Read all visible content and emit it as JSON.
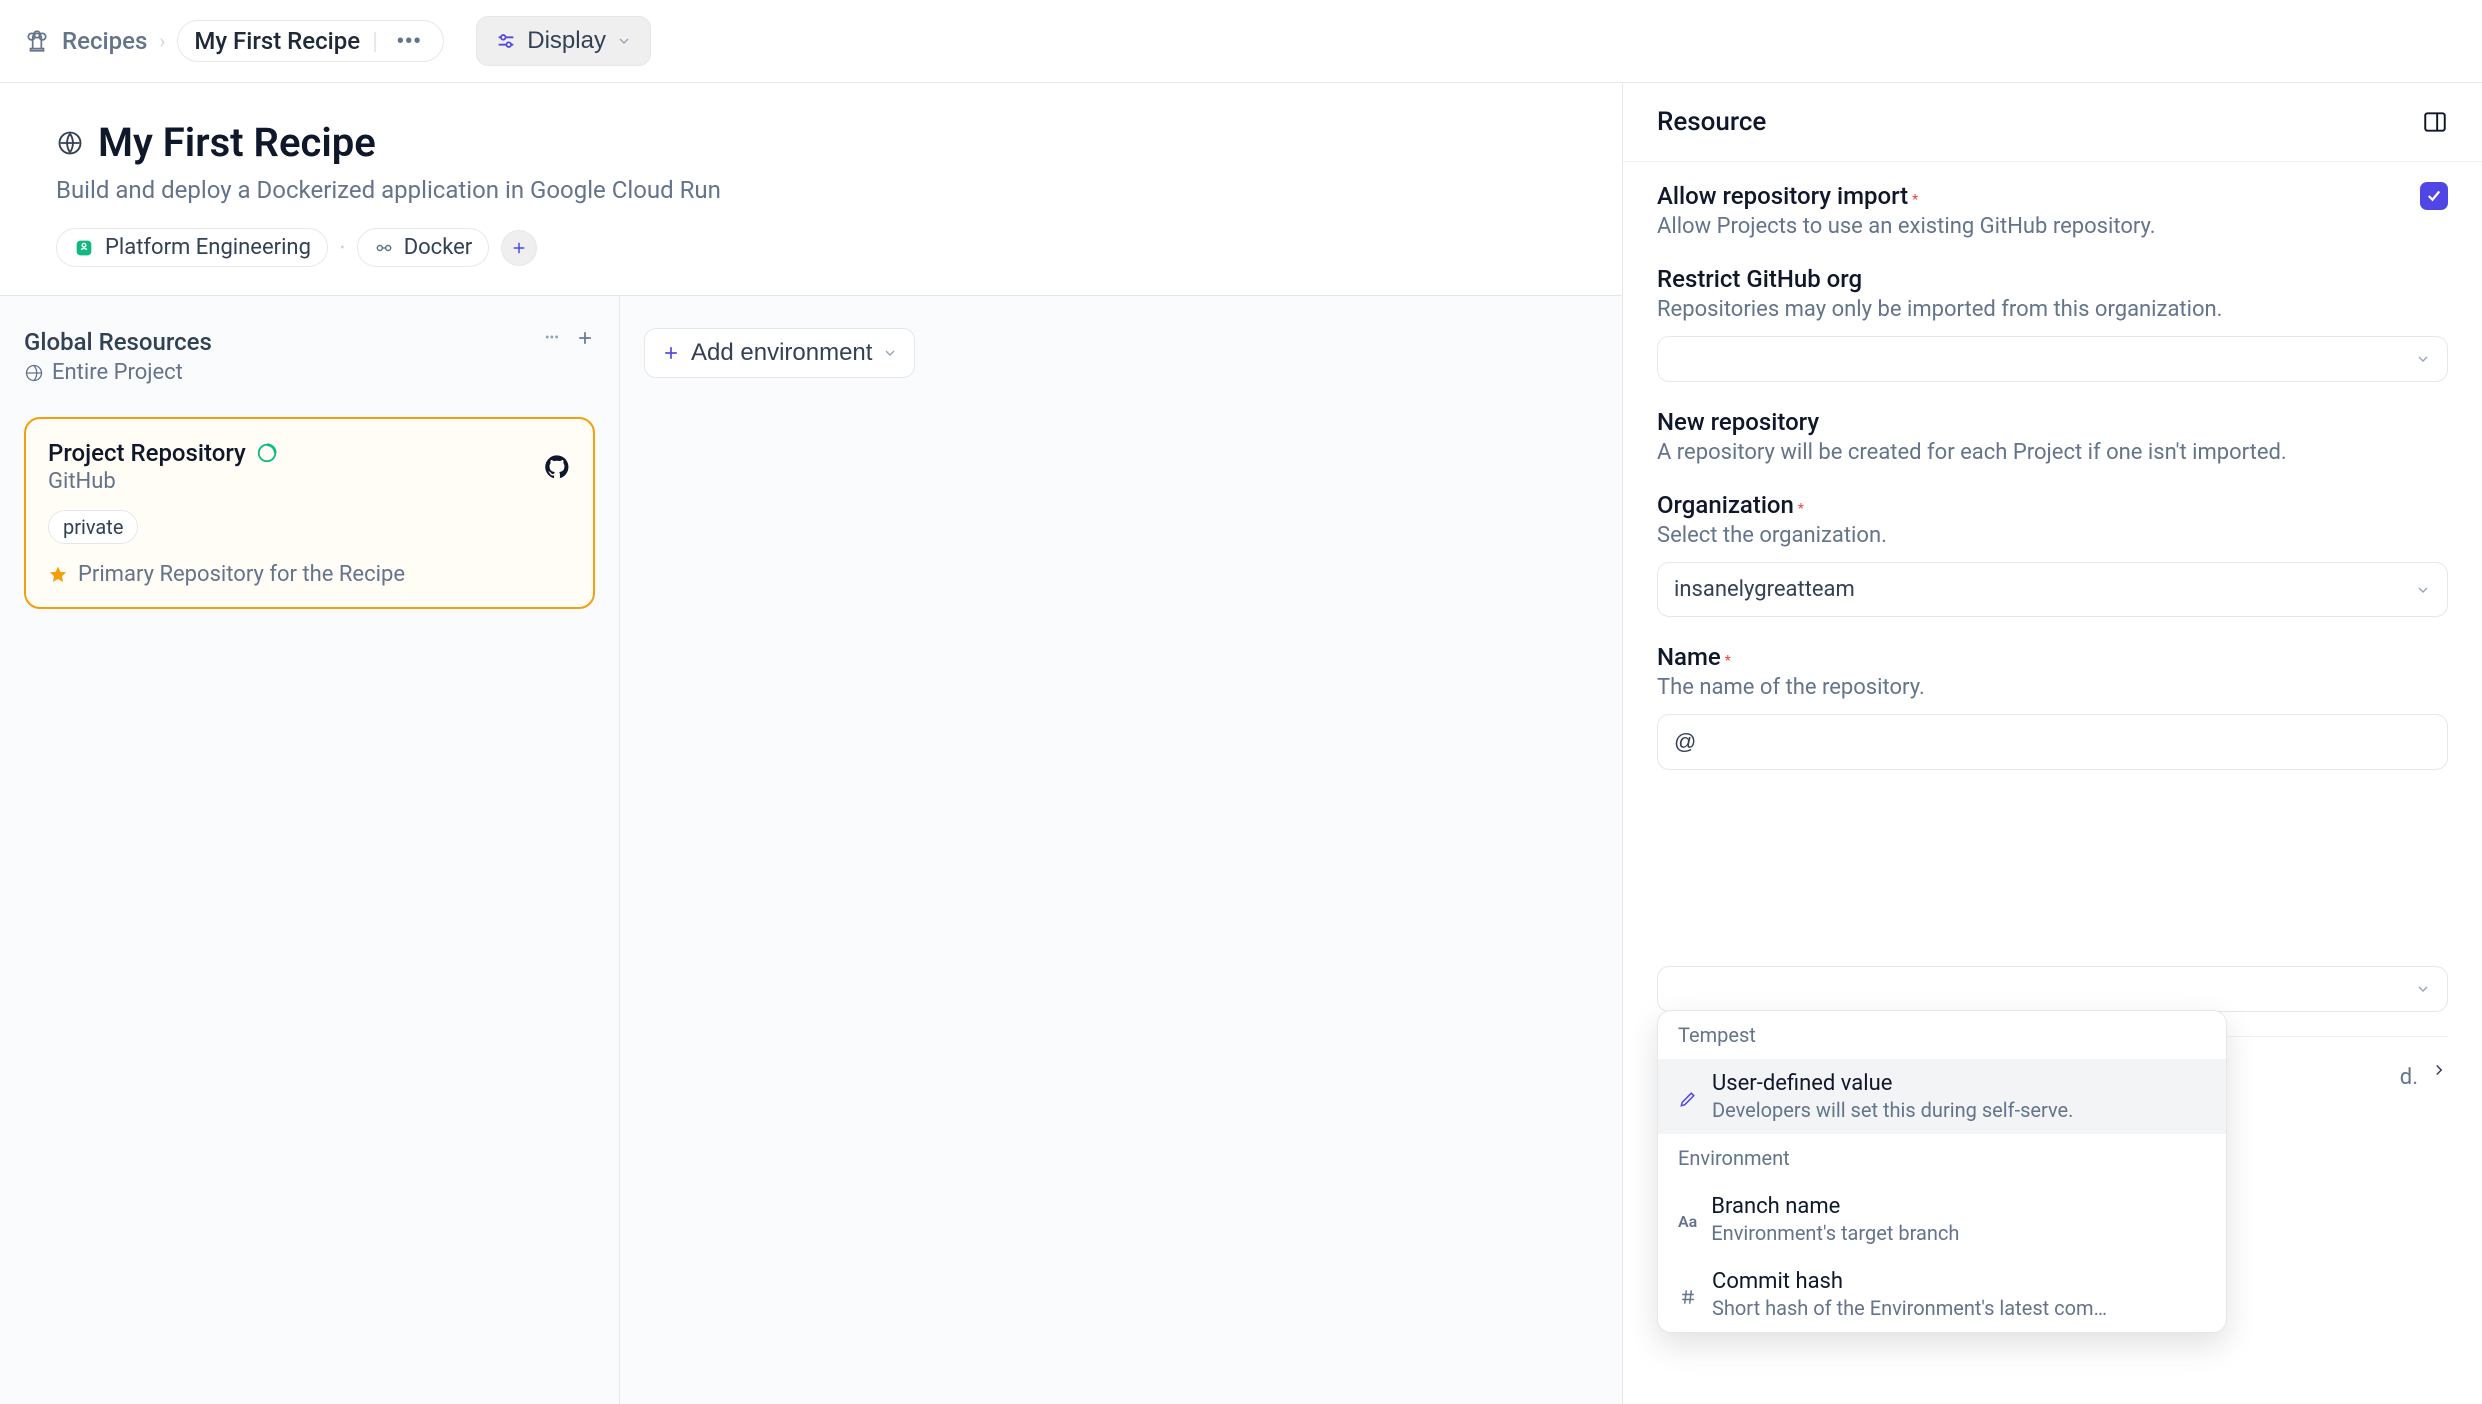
{
  "breadcrumb": {
    "root": "Recipes",
    "current": "My First Recipe"
  },
  "display_button": "Display",
  "recipe": {
    "title": "My First Recipe",
    "subtitle": "Build and deploy a Dockerized application in Google Cloud Run",
    "tags": [
      "Platform Engineering",
      "Docker"
    ]
  },
  "global_resources": {
    "title": "Global Resources",
    "scope": "Entire Project"
  },
  "resource_card": {
    "title": "Project Repository",
    "provider": "GitHub",
    "chip": "private",
    "primary_note": "Primary Repository for the Recipe"
  },
  "add_env": "Add environment",
  "panel": {
    "title": "Resource",
    "allow_import": {
      "label": "Allow repository import",
      "help": "Allow Projects to use an existing GitHub repository."
    },
    "restrict_org": {
      "label": "Restrict GitHub org",
      "help": "Repositories may only be imported from this organization.",
      "value": ""
    },
    "new_repo": {
      "label": "New repository",
      "help": "A repository will be created for each Project if one isn't imported."
    },
    "organization": {
      "label": "Organization",
      "help": "Select the organization.",
      "value": "insanelygreatteam"
    },
    "name": {
      "label": "Name",
      "help": "The name of the repository.",
      "value": "@"
    },
    "hidden_label_end": "d."
  },
  "dropdown": {
    "group1": "Tempest",
    "opt1": {
      "name": "User-defined value",
      "desc": "Developers will set this during self-serve."
    },
    "group2": "Environment",
    "opt2": {
      "name": "Branch name",
      "desc": "Environment's target branch"
    },
    "opt3": {
      "name": "Commit hash",
      "desc": "Short hash of the Environment's latest com…"
    }
  }
}
